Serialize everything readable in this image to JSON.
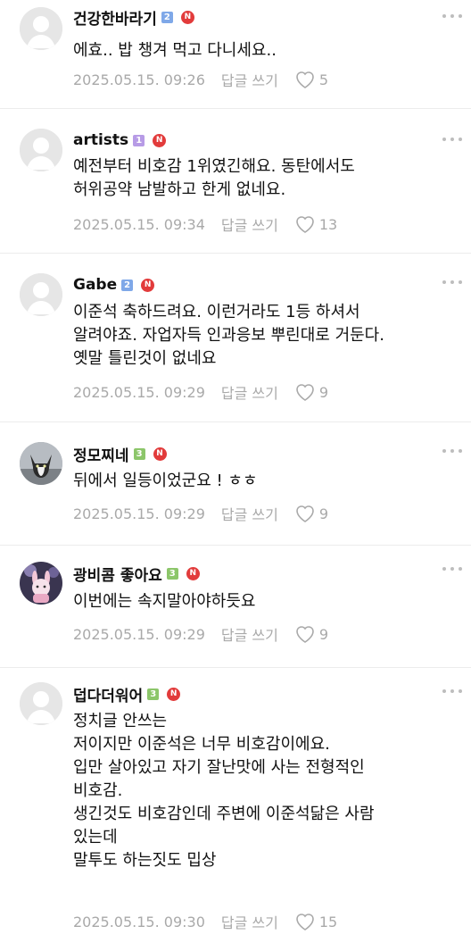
{
  "comments": [
    {
      "nickname": "건강한바라기",
      "level": "2",
      "new_badge": "N",
      "lines": [
        "에효.. 밥 챙겨 먹고 다니세요.."
      ],
      "date": "2025.05.15. 09:26",
      "reply": "답글 쓰기",
      "likes": "5"
    },
    {
      "nickname": "artists",
      "level": "1",
      "new_badge": "N",
      "lines": [
        "예전부터 비호감 1위였긴해요. 동탄에서도",
        "허위공약 남발하고 한게 없네요."
      ],
      "date": "2025.05.15. 09:34",
      "reply": "답글 쓰기",
      "likes": "13"
    },
    {
      "nickname": "Gabe",
      "level": "2",
      "new_badge": "N",
      "lines": [
        "이준석 축하드려요. 이런거라도 1등 하셔서",
        "알려야죠. 자업자득 인과응보 뿌린대로 거둔다.",
        "옛말 틀린것이 없네요"
      ],
      "date": "2025.05.15. 09:29",
      "reply": "답글 쓰기",
      "likes": "9"
    },
    {
      "nickname": "정모찌네",
      "level": "3",
      "new_badge": "N",
      "lines": [
        "뒤에서 일등이었군요 ! ㅎㅎ"
      ],
      "date": "2025.05.15. 09:29",
      "reply": "답글 쓰기",
      "likes": "9"
    },
    {
      "nickname": "광비콤 좋아요",
      "level": "3",
      "new_badge": "N",
      "lines": [
        "이번에는 속지말아야하듯요"
      ],
      "date": "2025.05.15. 09:29",
      "reply": "답글 쓰기",
      "likes": "9"
    },
    {
      "nickname": "덥다더워어",
      "level": "3",
      "new_badge": "N",
      "lines": [
        "정치글 안쓰는",
        "저이지만 이준석은 너무 비호감이에요.",
        "입만 살아있고 자기 잘난맛에 사는 전형적인",
        "비호감.",
        "생긴것도 비호감인데 주변에 이준석닮은 사람",
        "있는데",
        "말투도 하는짓도 밉상"
      ],
      "date": "2025.05.15. 09:30",
      "reply": "답글 쓰기",
      "likes": "15"
    }
  ],
  "colors": {
    "level_blue": "#7fa8e8",
    "level_purple": "#b79be6",
    "level_green": "#8cc66a",
    "new_badge": "#e23b3b",
    "meta_text": "#a9a9a9"
  },
  "icons": [
    "default-avatar-icon",
    "heart-outline-icon",
    "more-dots-icon"
  ]
}
